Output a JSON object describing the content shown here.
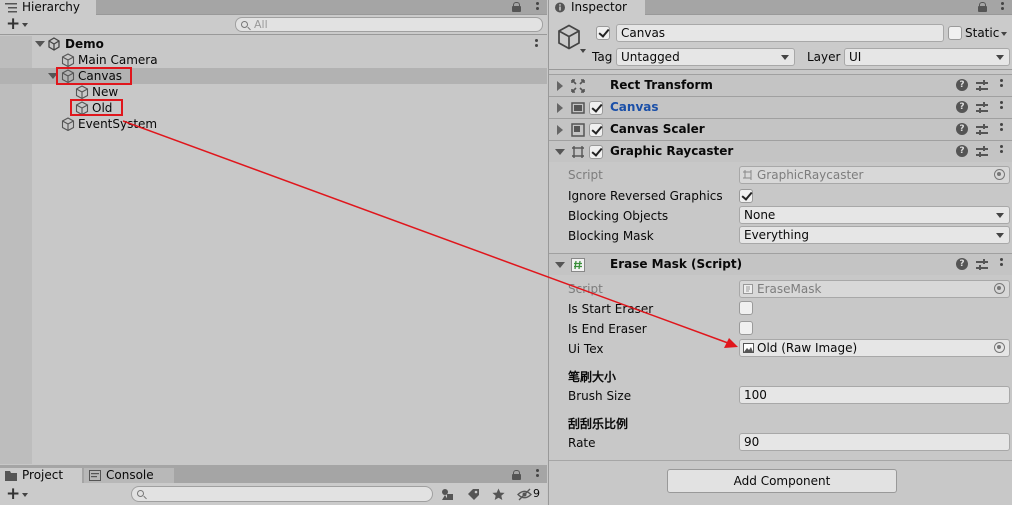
{
  "hierarchy": {
    "tab_label": "Hierarchy",
    "search_placeholder": "All",
    "scene_name": "Demo",
    "items": [
      {
        "label": "Main Camera"
      },
      {
        "label": "Canvas"
      },
      {
        "label": "New"
      },
      {
        "label": "Old"
      },
      {
        "label": "EventSystem"
      }
    ]
  },
  "project": {
    "tabs": [
      {
        "label": "Project"
      },
      {
        "label": "Console"
      }
    ],
    "hidden_count": "9"
  },
  "inspector": {
    "tab_label": "Inspector",
    "object_name": "Canvas",
    "static_label": "Static",
    "tag_label": "Tag",
    "tag_value": "Untagged",
    "layer_label": "Layer",
    "layer_value": "UI",
    "components": {
      "rect_transform": {
        "title": "Rect Transform"
      },
      "canvas": {
        "title": "Canvas"
      },
      "canvas_scaler": {
        "title": "Canvas Scaler"
      },
      "graphic_raycaster": {
        "title": "Graphic Raycaster",
        "script_label": "Script",
        "script_value": "GraphicRaycaster",
        "ignore_reversed_label": "Ignore Reversed Graphics",
        "blocking_objects_label": "Blocking Objects",
        "blocking_objects_value": "None",
        "blocking_mask_label": "Blocking Mask",
        "blocking_mask_value": "Everything"
      },
      "erase_mask": {
        "title": "Erase Mask (Script)",
        "script_label": "Script",
        "script_value": "EraseMask",
        "is_start_label": "Is Start Eraser",
        "is_end_label": "Is End Eraser",
        "ui_tex_label": "Ui Tex",
        "ui_tex_value": "Old (Raw Image)",
        "brush_header": "笔刷大小",
        "brush_size_label": "Brush Size",
        "brush_size_value": "100",
        "rate_header": "刮刮乐比例",
        "rate_label": "Rate",
        "rate_value": "90"
      }
    },
    "add_component_label": "Add Component"
  },
  "colors": {
    "highlight": "#e0161c",
    "canvas_title": "#1a4fa8"
  }
}
